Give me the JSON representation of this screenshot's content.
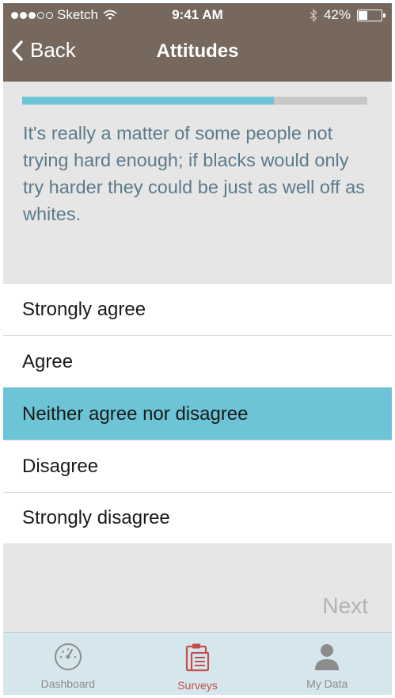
{
  "status_bar": {
    "carrier": "Sketch",
    "time": "9:41 AM",
    "battery": "42%",
    "battery_level": 0.42
  },
  "nav": {
    "back_label": "Back",
    "title": "Attitudes"
  },
  "progress": {
    "value": 0.73
  },
  "question": {
    "text": "It's really a matter of some people not trying hard enough; if blacks would only try harder they could be just as well off as whites."
  },
  "options": [
    {
      "label": "Strongly agree",
      "selected": false
    },
    {
      "label": "Agree",
      "selected": false
    },
    {
      "label": "Neither agree nor disagree",
      "selected": true
    },
    {
      "label": "Disagree",
      "selected": false
    },
    {
      "label": "Strongly disagree",
      "selected": false
    }
  ],
  "next_label": "Next",
  "tabs": [
    {
      "label": "Dashboard",
      "icon": "dashboard-icon",
      "active": false
    },
    {
      "label": "Surveys",
      "icon": "clipboard-icon",
      "active": true
    },
    {
      "label": "My Data",
      "icon": "person-icon",
      "active": false
    }
  ],
  "colors": {
    "header": "#76685d",
    "accent": "#6cc4d6",
    "question_text": "#5b7b8c",
    "active_tab": "#c44d4d",
    "tabbar": "#d5e7ed"
  }
}
